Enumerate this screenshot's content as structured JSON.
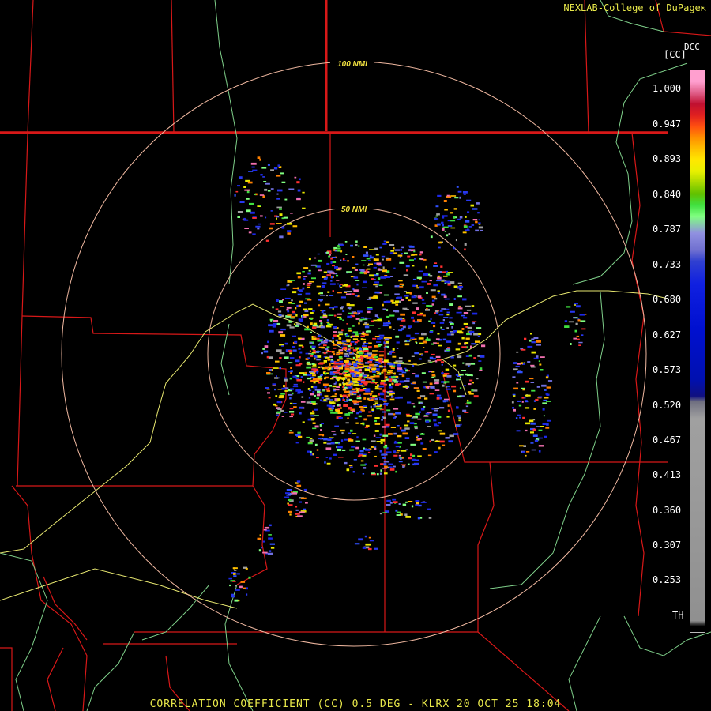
{
  "header": {
    "credit": "NEXLAB-College of DuPage",
    "credit_glyph": "⇱",
    "units": "[CC]",
    "product_code": "DCC"
  },
  "rings": {
    "inner_label": "50 NMI",
    "outer_label": "100 NMI"
  },
  "legend": {
    "scale_labels": [
      "1.000",
      "0.947",
      "0.893",
      "0.840",
      "0.787",
      "0.733",
      "0.680",
      "0.627",
      "0.573",
      "0.520",
      "0.467",
      "0.413",
      "0.360",
      "0.307",
      "0.253",
      "TH"
    ]
  },
  "footer": {
    "title": "CORRELATION COEFFICIENT (CC) 0.5 DEG - KLRX 20 OCT 25 18:04"
  },
  "colors": {
    "background": "#000000",
    "boundary_red": "#e01818",
    "highway_yellow": "#e8e870",
    "river_green": "#7fd08a",
    "ring_color": "#f0b8a0",
    "text_yellow": "#e8e84a"
  }
}
